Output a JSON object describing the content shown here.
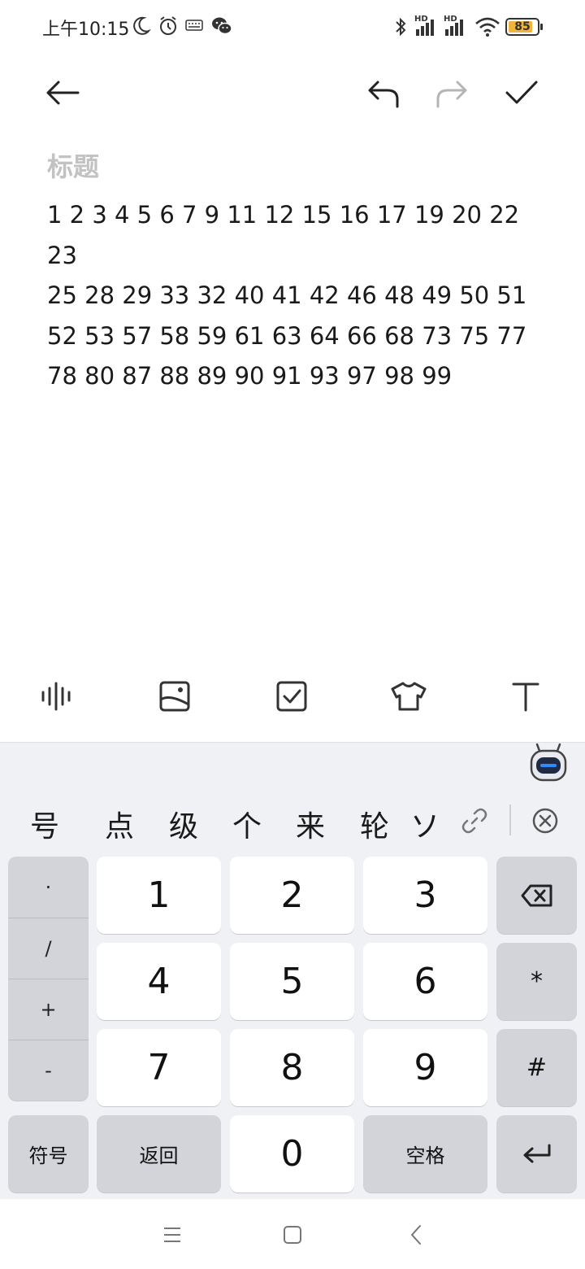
{
  "status_bar": {
    "time": "上午10:15",
    "signal_1_label": "HD",
    "signal_2_label": "HD",
    "battery_level": "85",
    "icons": [
      "moon-icon",
      "alarm-icon",
      "keyboard-icon",
      "wechat-icon",
      "bluetooth-icon",
      "signal-icon",
      "wifi-icon",
      "battery-icon"
    ]
  },
  "toolbar": {
    "icons": [
      "back-arrow-icon",
      "undo-icon",
      "redo-icon",
      "check-icon"
    ]
  },
  "note": {
    "title_placeholder": "标题",
    "lines": [
      "1 2 3 4 5 6 7 9 11 12 15 16 17 19 20 22 23",
      "25 28 29 33 32 40 41 42 46 48 49 50 51",
      "52 53 57 58 59 61 63 64 66 68 73 75 77",
      "78 80 87 88 89 90 91 93 97 98 99"
    ]
  },
  "format_toolbar": {
    "icons": [
      "voice-wave-icon",
      "image-icon",
      "checkbox-icon",
      "shirt-icon",
      "text-format-icon"
    ]
  },
  "keyboard": {
    "candidates": [
      "号",
      "点",
      "级",
      "个",
      "来",
      "轮",
      "ソ"
    ],
    "symbols": [
      "·",
      "/",
      "+",
      "-"
    ],
    "digits": [
      "1",
      "2",
      "3",
      "4",
      "5",
      "6",
      "7",
      "8",
      "9",
      "0"
    ],
    "star": "*",
    "hash": "#",
    "symbol_key": "符号",
    "back_key": "返回",
    "space_key": "空格"
  },
  "colors": {
    "battery_fill": "#f0b43c",
    "keyboard_bg": "#f0f1f4",
    "key_white": "#ffffff",
    "key_gray": "#d2d4d9",
    "placeholder": "#c2c2c2",
    "assistant_glow": "#2f8cff"
  }
}
